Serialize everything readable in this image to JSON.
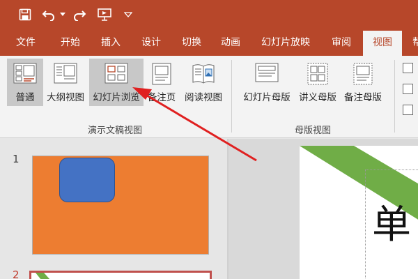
{
  "tabs": [
    {
      "label": "文件"
    },
    {
      "label": "开始"
    },
    {
      "label": "插入"
    },
    {
      "label": "设计"
    },
    {
      "label": "切换"
    },
    {
      "label": "动画"
    },
    {
      "label": "幻灯片放映"
    },
    {
      "label": "审阅"
    },
    {
      "label": "视图"
    },
    {
      "label": "帮"
    }
  ],
  "active_tab": "视图",
  "ribbon": {
    "presentation_views": {
      "group_label": "演示文稿视图",
      "buttons": [
        {
          "label": "普通",
          "icon": "normal-view-icon"
        },
        {
          "label": "大纲视图",
          "icon": "outline-view-icon"
        },
        {
          "label": "幻灯片浏览",
          "icon": "slide-sorter-icon",
          "selected": true
        },
        {
          "label": "备注页",
          "icon": "notes-page-icon"
        },
        {
          "label": "阅读视图",
          "icon": "reading-view-icon"
        }
      ]
    },
    "master_views": {
      "group_label": "母版视图",
      "buttons": [
        {
          "label": "幻灯片母版",
          "icon": "slide-master-icon"
        },
        {
          "label": "讲义母版",
          "icon": "handout-master-icon"
        },
        {
          "label": "备注母版",
          "icon": "notes-master-icon"
        }
      ]
    }
  },
  "thumbnails": [
    {
      "number": "1"
    },
    {
      "number": "2",
      "selected": true
    }
  ],
  "editor": {
    "visible_text": "单"
  },
  "colors": {
    "accent": "#b7472a",
    "ribbon_bg": "#f3f3f3",
    "slide1_bg": "#ed7d31",
    "slide1_shape": "#4472c4",
    "green_band": "#70ad47",
    "arrow": "#e02020"
  }
}
